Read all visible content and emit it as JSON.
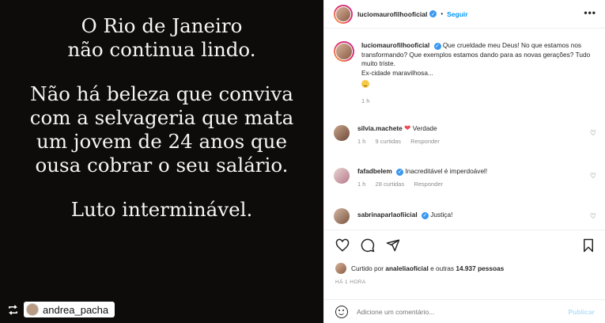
{
  "media": {
    "lines": [
      [
        "O Rio de Janeiro",
        "não continua lindo."
      ],
      [
        "Não há beleza que conviva",
        "com a selvageria que mata",
        "um jovem de 24 anos que",
        "ousa cobrar o seu salário."
      ],
      [
        "Luto interminável."
      ]
    ],
    "repost_user": "andrea_pacha"
  },
  "header": {
    "username": "luciomaurofilhooficial",
    "follow_label": "Seguir",
    "separator": "•",
    "more_label": "•••"
  },
  "caption": {
    "username": "luciomaurofilhooficial",
    "text": "Que crueldade meu Deus! No que estamos nos transformando? Que exemplos estamos dando para as novas gerações? Tudo muito triste.",
    "text2": "Ex-cidade maravilhosa...",
    "time": "1 h"
  },
  "comments": [
    {
      "username": "silvia.machete",
      "text": "Verdade",
      "time": "1 h",
      "likes": "9 curtidas",
      "reply": "Responder",
      "has_heart": true
    },
    {
      "username": "fafadbelem",
      "text": "Inacreditável é imperdoável!",
      "time": "1 h",
      "likes": "28 curtidas",
      "reply": "Responder",
      "has_heart": false
    },
    {
      "username": "sabrinaparlaofiicial",
      "text": "Justiça!",
      "time": "",
      "likes": "",
      "reply": "",
      "has_heart": false
    }
  ],
  "actions": {
    "liked_prefix": "Curtido por",
    "liked_user": "analeliaoficial",
    "liked_suffix": "e outras",
    "liked_count": "14.937 pessoas",
    "time_ago": "HÁ 1 HORA",
    "comment_placeholder": "Adicione um comentário...",
    "publish_label": "Publicar"
  },
  "icons": {
    "like": "heart-icon",
    "comment": "comment-icon",
    "share": "share-icon",
    "save": "bookmark-icon",
    "emoji": "emoji-icon",
    "repost": "repost-icon"
  },
  "colors": {
    "accent": "#0095f6",
    "verified": "#3897f0",
    "heart": "#ed4956",
    "muted": "#8e8e8e"
  }
}
